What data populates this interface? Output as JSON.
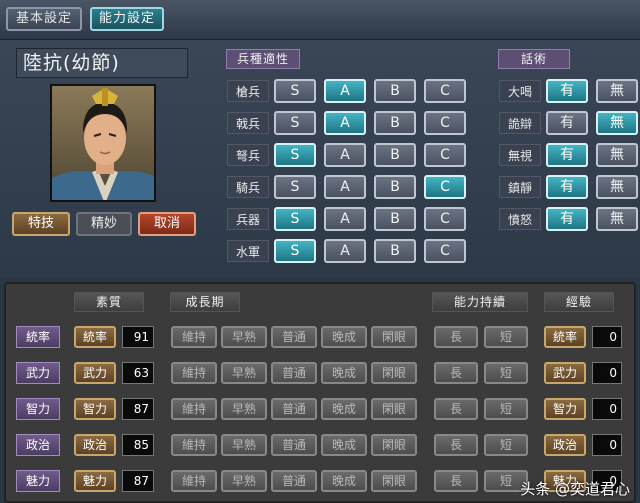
{
  "tabs": [
    {
      "label": "基本設定",
      "active": false
    },
    {
      "label": "能力設定",
      "active": true
    }
  ],
  "general": {
    "name": "陸抗(幼節)",
    "buttons": {
      "skill": "特技",
      "skill_value": "精妙",
      "cancel": "取消"
    }
  },
  "aptitude": {
    "header": "兵種適性",
    "grades": [
      "S",
      "A",
      "B",
      "C"
    ],
    "rows": [
      {
        "label": "槍兵",
        "selected": "A"
      },
      {
        "label": "戟兵",
        "selected": "A"
      },
      {
        "label": "弩兵",
        "selected": "S"
      },
      {
        "label": "騎兵",
        "selected": "C"
      },
      {
        "label": "兵器",
        "selected": "S"
      },
      {
        "label": "水軍",
        "selected": "S"
      }
    ]
  },
  "tactics": {
    "header": "話術",
    "options": [
      "有",
      "無"
    ],
    "rows": [
      {
        "label": "大喝",
        "selected": "有"
      },
      {
        "label": "詭辯",
        "selected": "無"
      },
      {
        "label": "無視",
        "selected": "有"
      },
      {
        "label": "鎮靜",
        "selected": "有"
      },
      {
        "label": "憤怒",
        "selected": "有"
      }
    ]
  },
  "stats": {
    "headers": {
      "quality": "素質",
      "growth": "成長期",
      "sustain": "能力持續",
      "exp": "經驗"
    },
    "growth_options": [
      "維持",
      "早熟",
      "普通",
      "晚成",
      "閑眼"
    ],
    "sustain_options": [
      "長",
      "短"
    ],
    "rows": [
      {
        "label": "統率",
        "button": "統率",
        "value": "91",
        "exp_button": "統率",
        "exp_value": "0"
      },
      {
        "label": "武力",
        "button": "武力",
        "value": "63",
        "exp_button": "武力",
        "exp_value": "0"
      },
      {
        "label": "智力",
        "button": "智力",
        "value": "87",
        "exp_button": "智力",
        "exp_value": "0"
      },
      {
        "label": "政治",
        "button": "政治",
        "value": "85",
        "exp_button": "政治",
        "exp_value": "0"
      },
      {
        "label": "魅力",
        "button": "魅力",
        "value": "87",
        "exp_button": "魅力",
        "exp_value": "0"
      }
    ]
  },
  "watermark": "头条 @奕道君心"
}
